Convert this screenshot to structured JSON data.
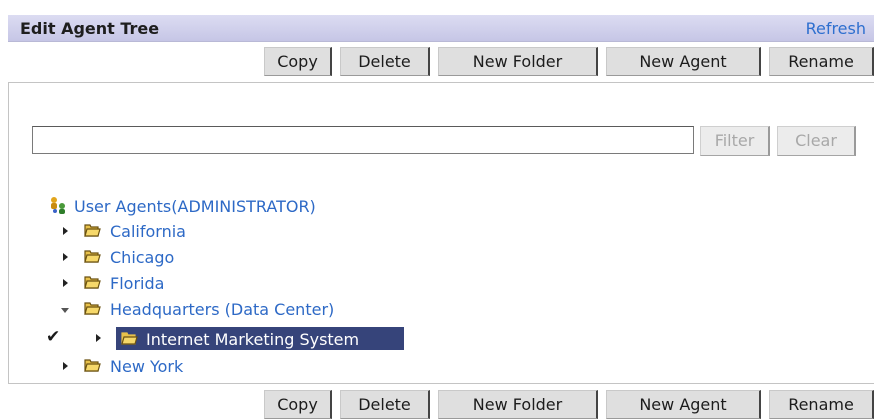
{
  "header": {
    "title": "Edit Agent Tree",
    "refresh": "Refresh"
  },
  "toolbar": {
    "buttons": [
      "Copy",
      "Delete",
      "New Folder",
      "New Agent",
      "Rename"
    ]
  },
  "filter": {
    "value": "",
    "placeholder": "",
    "filter_label": "Filter",
    "clear_label": "Clear"
  },
  "tree": {
    "root": {
      "label": "User Agents(ADMINISTRATOR)"
    },
    "nodes": [
      {
        "label": "California",
        "state": "collapsed"
      },
      {
        "label": "Chicago",
        "state": "collapsed"
      },
      {
        "label": "Florida",
        "state": "collapsed"
      },
      {
        "label": "Headquarters (Data Center)",
        "state": "expanded"
      },
      {
        "label": "Internet Marketing System",
        "state": "collapsed",
        "selected": true,
        "checked": true
      },
      {
        "label": "New York",
        "state": "collapsed"
      }
    ],
    "check_mark": "✔"
  },
  "colors": {
    "header_bg": "#c6c6e6",
    "link": "#2d69c6",
    "selection": "#36447a"
  },
  "icons": {
    "root": "agents-root-icon",
    "folder": "folder-icon",
    "expand": "triangle-right-icon",
    "collapse": "triangle-down-icon",
    "check": "checkmark-icon"
  }
}
